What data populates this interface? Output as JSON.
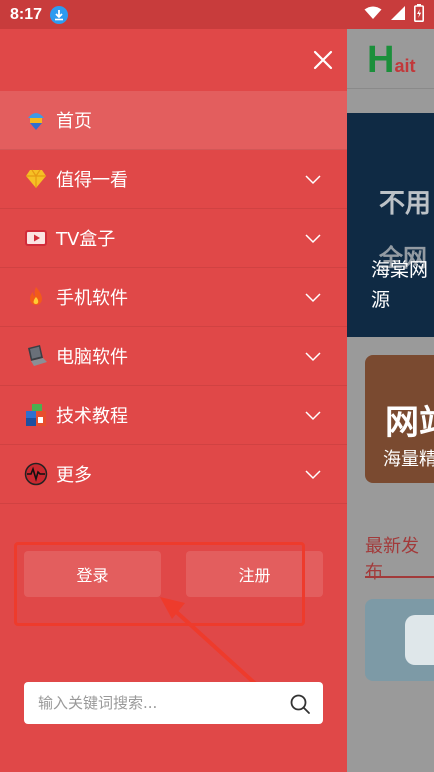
{
  "status_bar": {
    "time": "8:17"
  },
  "background_page": {
    "logo_initial": "H",
    "logo_rest": "ait",
    "banner_line1": "不用",
    "banner_line2": "全网",
    "banner_caption_line1": "海棠网",
    "banner_caption_line2": "源",
    "card_title": "网站",
    "card_caption": "海量精",
    "section_title": "最新发布"
  },
  "drawer": {
    "menu": [
      {
        "label": "首页",
        "icon": "home-icon",
        "expandable": false,
        "active": true
      },
      {
        "label": "值得一看",
        "icon": "diamond-icon",
        "expandable": true
      },
      {
        "label": "TV盒子",
        "icon": "tv-icon",
        "expandable": true
      },
      {
        "label": "手机软件",
        "icon": "fire-icon",
        "expandable": true
      },
      {
        "label": "电脑软件",
        "icon": "laptop-icon",
        "expandable": true
      },
      {
        "label": "技术教程",
        "icon": "blocks-icon",
        "expandable": true
      },
      {
        "label": "更多",
        "icon": "pulse-icon",
        "expandable": true
      }
    ],
    "login_label": "登录",
    "register_label": "注册",
    "search": {
      "placeholder": "输入关键词搜索..."
    }
  },
  "colors": {
    "drawer_bg": "#e04848",
    "status_bar": "#c83c3c",
    "annotation": "#ee3b2c"
  }
}
